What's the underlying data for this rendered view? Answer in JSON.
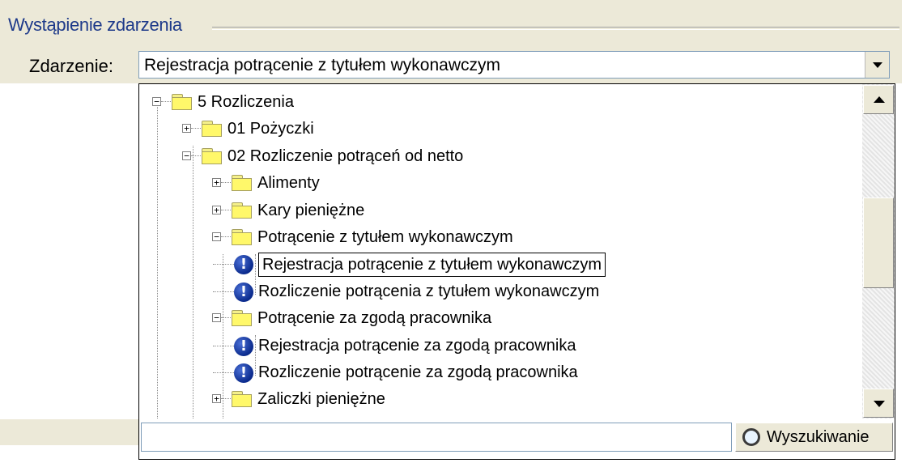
{
  "groupbox": {
    "title": "Wystąpienie zdarzenia"
  },
  "field": {
    "label": "Zdarzenie:",
    "value": "Rejestracja potrącenie z tytułem wykonawczym"
  },
  "tree": {
    "nodes": [
      {
        "label": "5 Rozliczenia",
        "type": "folder",
        "expanded": true
      },
      {
        "label": "01 Pożyczki",
        "type": "folder",
        "expanded": false
      },
      {
        "label": "02 Rozliczenie potrąceń od netto",
        "type": "folder",
        "expanded": true
      },
      {
        "label": "Alimenty",
        "type": "folder",
        "expanded": false
      },
      {
        "label": "Kary pieniężne",
        "type": "folder",
        "expanded": false
      },
      {
        "label": "Potrącenie z tytułem wykonawczym",
        "type": "folder",
        "expanded": true
      },
      {
        "label": "Rejestracja potrącenie z tytułem wykonawczym",
        "type": "event",
        "selected": true
      },
      {
        "label": "Rozliczenie potrącenia z tytułem wykonawczym",
        "type": "event"
      },
      {
        "label": "Potrącenie za zgodą pracownika",
        "type": "folder",
        "expanded": true
      },
      {
        "label": "Rejestracja potrącenie za zgodą pracownika",
        "type": "event"
      },
      {
        "label": "Rozliczenie potrącenie za zgodą pracownika",
        "type": "event"
      },
      {
        "label": "Zaliczki pieniężne",
        "type": "folder",
        "expanded": false
      }
    ],
    "icon_names": {
      "folder": "folder-icon",
      "event": "exclamation-info-icon"
    }
  },
  "search": {
    "input_value": "",
    "button_label": "Wyszukiwanie"
  },
  "colors": {
    "panel_bg": "#ece9d8",
    "groupbox_title": "#1e3a8a",
    "event_icon": "#0a2a8c",
    "folder": "#fff86a"
  }
}
